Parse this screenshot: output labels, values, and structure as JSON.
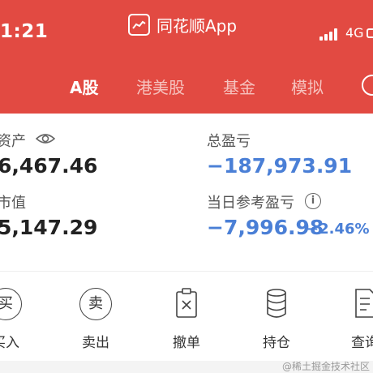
{
  "status": {
    "time": "1:21",
    "network": "4G"
  },
  "app": {
    "title": "同花顺App"
  },
  "tabs": [
    {
      "label": "A股",
      "active": true
    },
    {
      "label": "港美股",
      "active": false
    },
    {
      "label": "基金",
      "active": false
    },
    {
      "label": "模拟",
      "active": false
    }
  ],
  "summary": {
    "assets_label": "资产",
    "assets_value": "6,467.46",
    "market_label": "市值",
    "market_value": "5,147.29",
    "total_pl_label": "总盈亏",
    "total_pl_value": "−187,973.91",
    "daily_pl_label": "当日参考盈亏",
    "daily_pl_value": "−7,996.98",
    "daily_pl_pct": "−2.46%"
  },
  "actions": [
    {
      "label": "买入",
      "icon": "buy-icon",
      "glyph": "买"
    },
    {
      "label": "卖出",
      "icon": "sell-icon",
      "glyph": "卖"
    },
    {
      "label": "撤单",
      "icon": "cancel-order-icon"
    },
    {
      "label": "持仓",
      "icon": "positions-icon"
    },
    {
      "label": "查询",
      "icon": "query-icon"
    }
  ],
  "watermark": "@稀土掘金技术社区",
  "colors": {
    "header": "#e24a42",
    "negative": "#4a7fd6"
  }
}
